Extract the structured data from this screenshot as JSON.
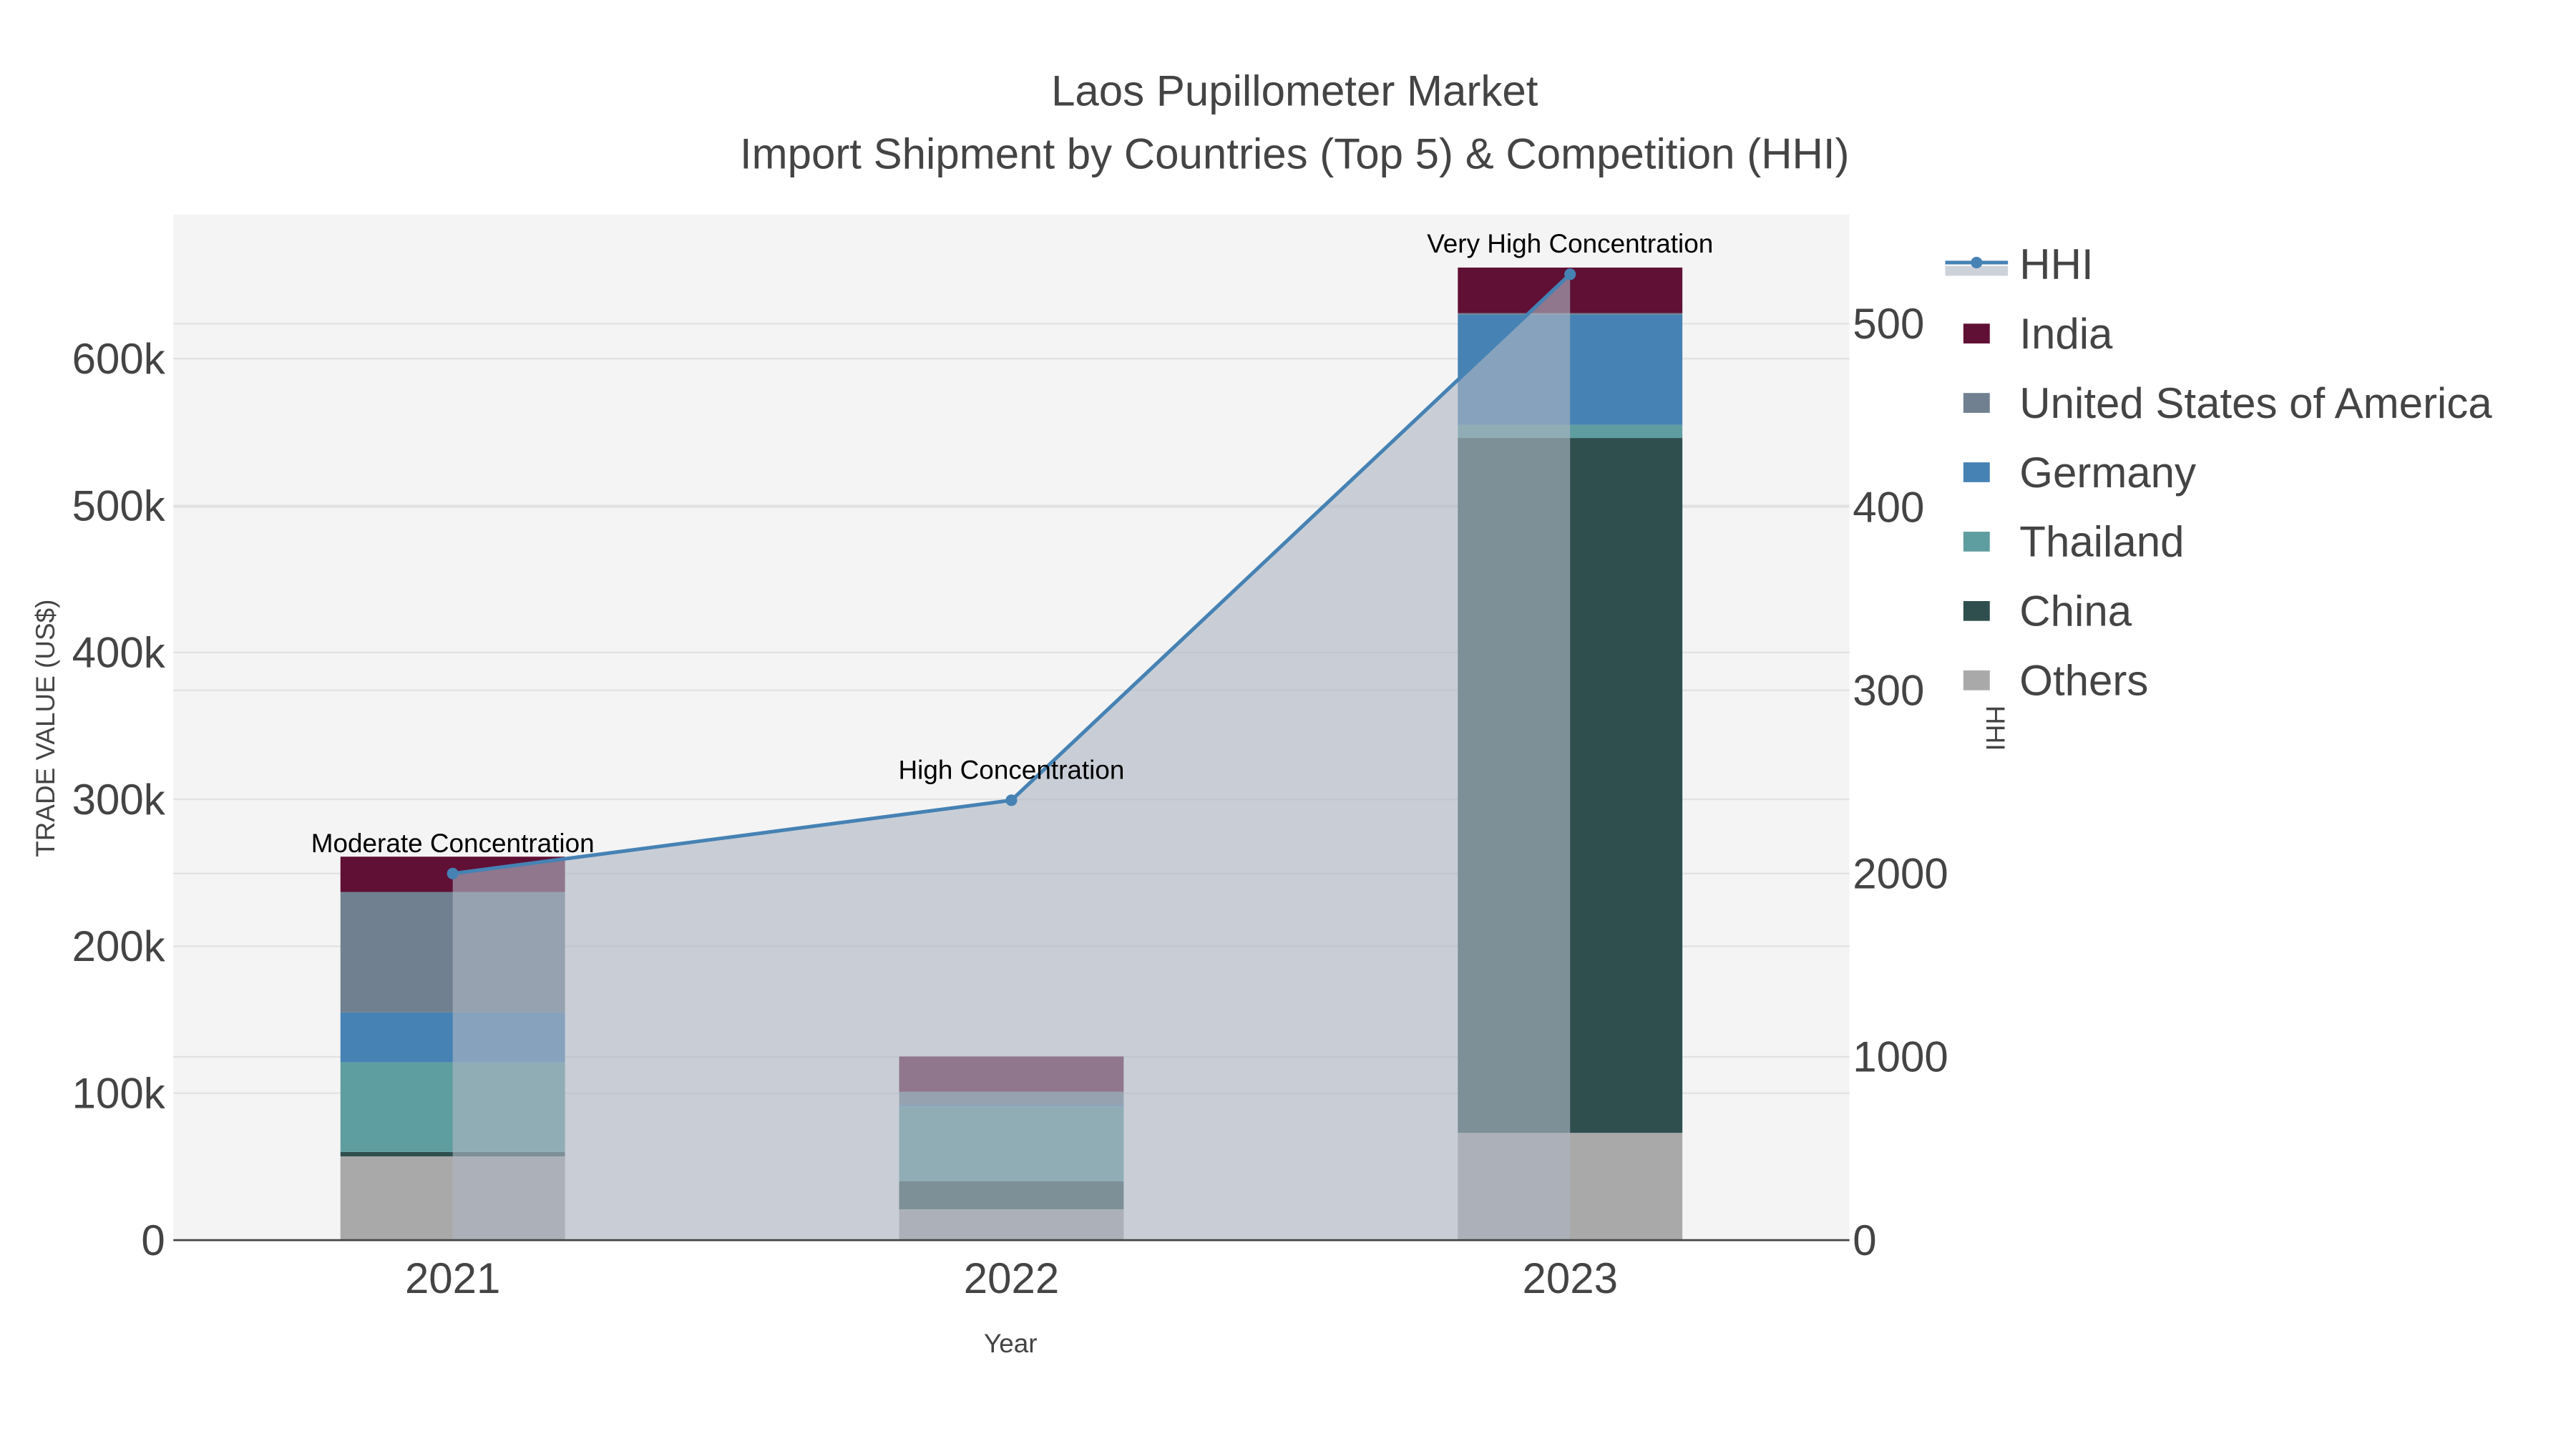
{
  "chart_data": {
    "type": "bar",
    "title": "Laos Pupillometer Market",
    "subtitle": "Import Shipment by Countries (Top 5) & Competition (HHI)",
    "xlabel": "Year",
    "ylabel": "TRADE VALUE (US$)",
    "y2label": "HHI",
    "categories": [
      "2021",
      "2022",
      "2023"
    ],
    "ylim": [
      0,
      698000
    ],
    "y2lim": [
      0,
      5595
    ],
    "yticks": [
      0,
      100000,
      200000,
      300000,
      400000,
      500000,
      600000
    ],
    "ytick_labels": [
      "0",
      "100k",
      "200k",
      "300k",
      "400k",
      "500k",
      "600k"
    ],
    "y2ticks": [
      0,
      1000,
      2000,
      3000,
      4000,
      5000
    ],
    "y2tick_labels": [
      "0",
      "1000",
      "2000",
      "300",
      "400",
      "500"
    ],
    "series": [
      {
        "name": "Others",
        "color": "#a9a9a9",
        "values": [
          57000,
          21000,
          73000
        ]
      },
      {
        "name": "China",
        "color": "#2f4f4f",
        "values": [
          3000,
          19000,
          473000
        ]
      },
      {
        "name": "Thailand",
        "color": "#5f9ea0",
        "values": [
          61000,
          51000,
          9000
        ]
      },
      {
        "name": "Germany",
        "color": "#4682b4",
        "values": [
          34000,
          1000,
          75000
        ]
      },
      {
        "name": "United States of America",
        "color": "#708090",
        "values": [
          82000,
          9000,
          1000
        ]
      },
      {
        "name": "India",
        "color": "#601035",
        "values": [
          24000,
          24000,
          31000
        ]
      }
    ],
    "hhi": {
      "name": "HHI",
      "color": "#4682b4",
      "values": [
        2000,
        2400,
        5270
      ]
    },
    "annotations": [
      "Moderate Concentration",
      "High Concentration",
      "Very High Concentration"
    ],
    "legend": [
      "HHI",
      "India",
      "United States of America",
      "Germany",
      "Thailand",
      "China",
      "Others"
    ],
    "legend_position": "top-right",
    "grid": true
  }
}
